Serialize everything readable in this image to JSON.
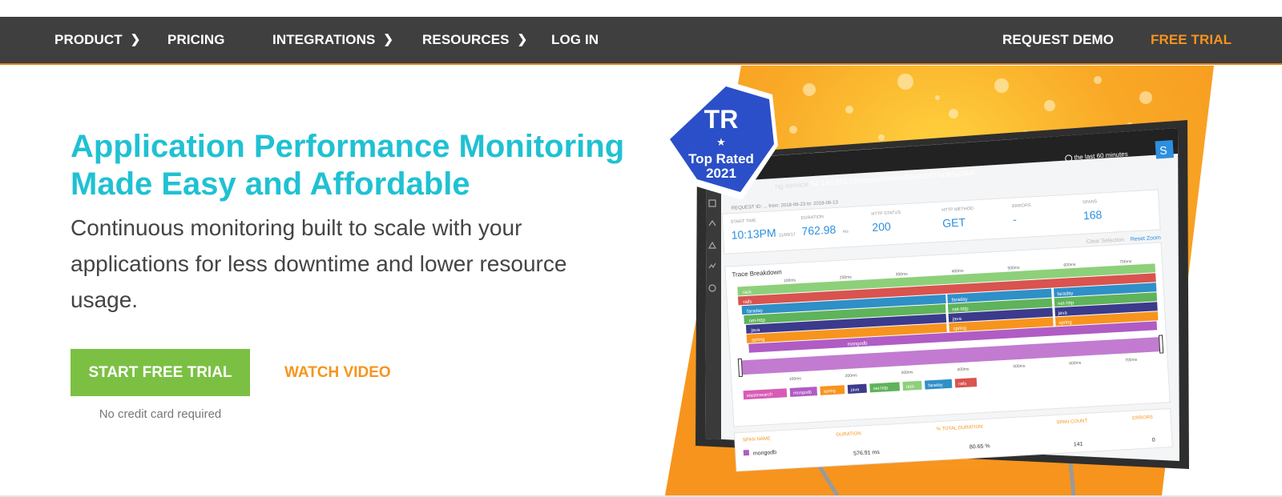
{
  "nav": {
    "items": [
      {
        "label": "PRODUCT",
        "has_submenu": true
      },
      {
        "label": "PRICING",
        "has_submenu": false
      },
      {
        "label": "INTEGRATIONS",
        "has_submenu": true
      },
      {
        "label": "RESOURCES",
        "has_submenu": true
      },
      {
        "label": "LOG IN",
        "has_submenu": false
      }
    ],
    "request_demo": "REQUEST DEMO",
    "free_trial": "FREE TRIAL",
    "chevron_icon": "chevron-right-icon"
  },
  "hero": {
    "title_line1": "Application Performance Monitoring",
    "title_line2": "Made Easy and Affordable",
    "subtitle": "Continuous monitoring built to scale with your applications for less downtime and lower resource usage.",
    "cta_primary": "START FREE TRIAL",
    "cta_secondary": "WATCH VIDEO",
    "cta_note": "No credit card required"
  },
  "badge": {
    "logo": "TR",
    "line1": "Top Rated",
    "line2": "2021"
  },
  "dashboard": {
    "service": "ng-service",
    "path": "54.145.253.72/hotels/59a6be58e4b0677a365a064f",
    "time_range": "the last 60 minutes",
    "avatar": "S",
    "meta": "REQUEST ID: ...  from: 2018-06-23   to: 2018-06-13",
    "metrics": [
      {
        "label": "START TIME",
        "value": "10:13PM",
        "unit": "11/09/17"
      },
      {
        "label": "DURATION",
        "value": "762.98",
        "unit": "ms"
      },
      {
        "label": "HTTP STATUS",
        "value": "200",
        "unit": ""
      },
      {
        "label": "HTTP METHOD",
        "value": "GET",
        "unit": ""
      },
      {
        "label": "ERRORS",
        "value": "-",
        "unit": ""
      },
      {
        "label": "SPANS",
        "value": "168",
        "unit": ""
      }
    ],
    "clear_selection": "Clear Selection",
    "reset_zoom": "Reset Zoom",
    "trace_title": "Trace Breakdown",
    "ticks": [
      "100ms",
      "200ms",
      "300ms",
      "400ms",
      "500ms",
      "600ms",
      "700ms"
    ],
    "legend": [
      "elasticsearch",
      "mongodb",
      "spring",
      "java",
      "net-http",
      "rack",
      "faraday",
      "rails"
    ],
    "table_headers": [
      "SPAN NAME",
      "DURATION",
      "% TOTAL DURATION",
      "SPAN COUNT",
      "ERRORS"
    ],
    "table_row": {
      "name": "mongodb",
      "duration": "576.91 ms",
      "pct": "80.65 %",
      "count": "141",
      "errors": "0"
    },
    "colors": {
      "rack": "#8dd07a",
      "rails": "#d9534f",
      "faraday": "#2f8fc7",
      "net_http": "#5fb35a",
      "java": "#3b3a8c",
      "spring": "#f7941d",
      "mongodb": "#b05cc4",
      "elasticsearch": "#d95bb5"
    }
  }
}
